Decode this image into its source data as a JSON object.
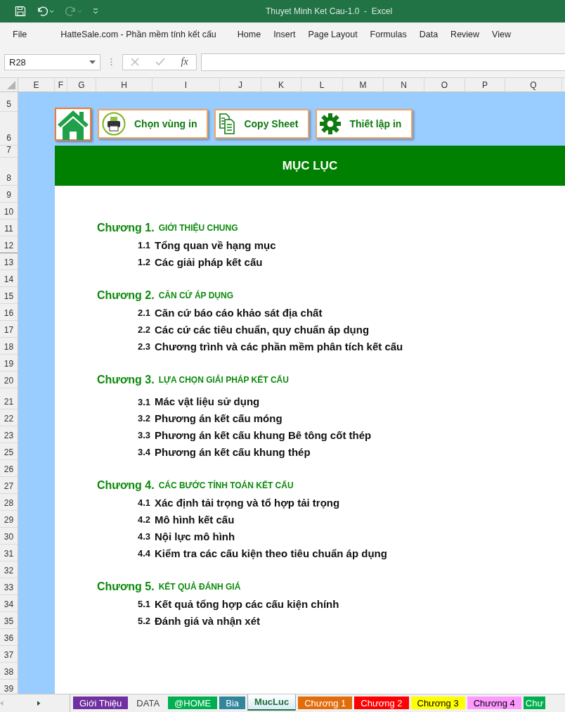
{
  "window": {
    "title": "Thuyet Minh Ket Cau-1.0  -  Excel"
  },
  "ribbon_tabs": [
    "File",
    "HatteSale.com - Phần mềm tính kết cấu",
    "Home",
    "Insert",
    "Page Layout",
    "Formulas",
    "Data",
    "Review",
    "View"
  ],
  "name_box": {
    "value": "R28"
  },
  "formula_label": "fx",
  "columns": [
    "E",
    "F",
    "G",
    "H",
    "I",
    "J",
    "K",
    "L",
    "M",
    "N",
    "O",
    "P",
    "Q"
  ],
  "rows": [
    "5",
    "6",
    "7",
    "8",
    "9",
    "10",
    "11",
    "12",
    "13",
    "14",
    "15",
    "16",
    "17",
    "18",
    "19",
    "20",
    "21",
    "22",
    "23",
    "25",
    "26",
    "27",
    "28",
    "29",
    "30",
    "31",
    "32",
    "33",
    "34",
    "35",
    "36",
    "37",
    "38",
    "39"
  ],
  "buttons": [
    {
      "kind": "home"
    },
    {
      "kind": "print",
      "label": "Chọn vùng in"
    },
    {
      "kind": "copy",
      "label": "Copy Sheet"
    },
    {
      "kind": "settings",
      "label": "Thiết lập in"
    }
  ],
  "heading": "MỤC LỤC",
  "chapters": [
    {
      "number": "Chương 1.",
      "title": "GIỚI THIỆU CHUNG",
      "sections": [
        {
          "number": "1.1",
          "title": "Tổng quan về hạng mục"
        },
        {
          "number": "1.2",
          "title": "Các giải pháp kết cấu"
        }
      ]
    },
    {
      "number": "Chương 2.",
      "title": "CĂN CỨ ÁP DỤNG",
      "sections": [
        {
          "number": "2.1",
          "title": "Căn cứ báo cáo khảo sát địa chất"
        },
        {
          "number": "2.2",
          "title": "Các cứ các tiêu chuẩn, quy chuẩn áp dụng"
        },
        {
          "number": "2.3",
          "title": "Chương trình và các phần mềm phân tích kết cấu"
        }
      ]
    },
    {
      "number": "Chương 3.",
      "title": "LỰA CHỌN GIẢI PHÁP KẾT CẤU",
      "sections": [
        {
          "number": "3.1",
          "title": "Mác vật liệu sử dụng"
        },
        {
          "number": "3.2",
          "title": "Phương án kết cấu móng"
        },
        {
          "number": "3.3",
          "title": "Phương án kết cấu khung Bê tông cốt thép"
        },
        {
          "number": "3.4",
          "title": "Phương án kết cấu khung thép"
        }
      ]
    },
    {
      "number": "Chương 4.",
      "title": "CÁC BƯỚC TÍNH TOÁN KẾT CẤU",
      "sections": [
        {
          "number": "4.1",
          "title": "Xác định tải trọng và tổ hợp tải trọng"
        },
        {
          "number": "4.2",
          "title": "Mô hình kết cấu"
        },
        {
          "number": "4.3",
          "title": "Nội lực mô hình"
        },
        {
          "number": "4.4",
          "title": "Kiểm tra các cấu kiện theo tiêu chuẩn áp dụng"
        }
      ]
    },
    {
      "number": "Chương 5.",
      "title": "KẾT QUẢ ĐÁNH GIÁ",
      "sections": [
        {
          "number": "5.1",
          "title": "Kết quả tổng hợp các cấu kiện chính"
        },
        {
          "number": "5.2",
          "title": "Đánh giá và nhận xét"
        }
      ]
    }
  ],
  "sheet_tabs": [
    {
      "label": "Giới Thiệu",
      "color": "#7030a0",
      "selected": false
    },
    {
      "label": "DATA",
      "selected": false
    },
    {
      "label": "@HOME",
      "color": "#00b050",
      "selected": false
    },
    {
      "label": "Bia",
      "color": "#31869b",
      "selected": false
    },
    {
      "label": "MucLuc",
      "selected": true
    },
    {
      "label": "Chương 1",
      "color": "#e26b0a",
      "selected": false
    },
    {
      "label": "Chương 2",
      "color": "#ff0000",
      "selected": false
    },
    {
      "label": "Chương 3",
      "color": "#ffff00",
      "selected": false
    },
    {
      "label": "Chương 4",
      "color": "#ff99ff",
      "selected": false
    },
    {
      "label": "Chư",
      "color": "#00b050",
      "selected": false
    }
  ]
}
